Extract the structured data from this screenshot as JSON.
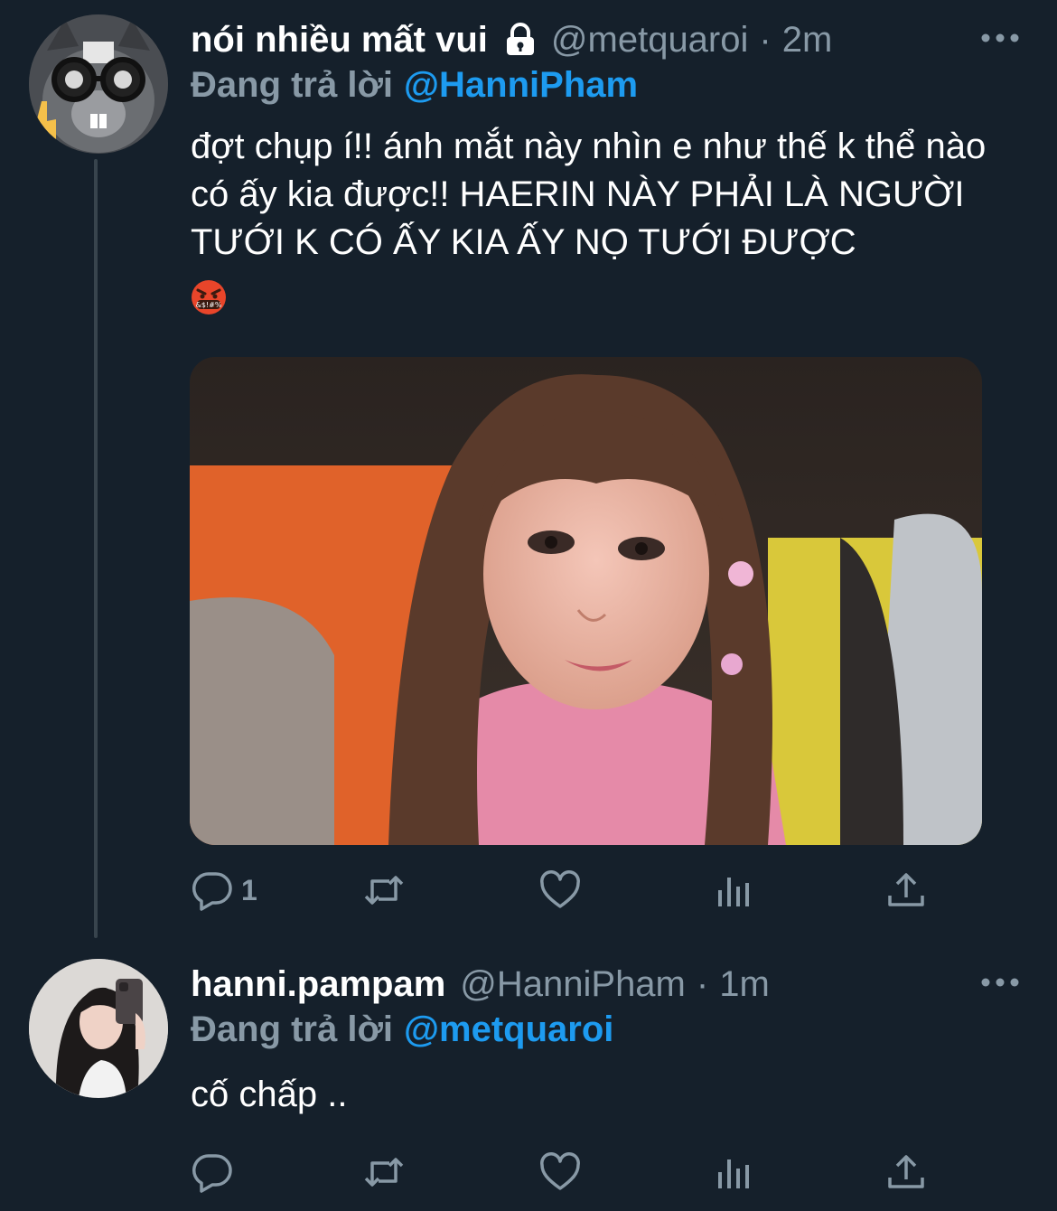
{
  "tweets": [
    {
      "display_name": "nói nhiều mất vui",
      "handle": "@metquaroi",
      "separator": "·",
      "time": "2m",
      "reply_prefix": "Đang trả lời",
      "reply_to": "@HanniPham",
      "text": "đợt chụp í!! ánh mắt này nhìn e như thế k thể nào có ấy kia được!! HAERIN NÀY PHẢI LÀ NGƯỜI TƯỚI K CÓ ẤY KIA ẤY NỌ TƯỚI ĐƯỢC",
      "emoji": "face-with-symbols-on-mouth",
      "protected": true,
      "actions": {
        "reply_count": "1"
      }
    },
    {
      "display_name": "hanni.pampam",
      "handle": "@HanniPham",
      "separator": "·",
      "time": "1m",
      "reply_prefix": "Đang trả lời",
      "reply_to": "@metquaroi",
      "text": "cố chấp ..",
      "protected": false,
      "actions": {
        "reply_count": ""
      }
    }
  ],
  "icons": {
    "reply": "speech-bubble-icon",
    "retweet": "retweet-icon",
    "like": "heart-icon",
    "analytics": "bar-chart-icon",
    "share": "share-upload-icon",
    "more": "more-dots-icon",
    "lock": "lock-icon"
  },
  "colors": {
    "background": "#15202b",
    "text_primary": "#ffffff",
    "text_secondary": "#8899a6",
    "link": "#1d9bf0",
    "thread_line": "#38444d"
  }
}
